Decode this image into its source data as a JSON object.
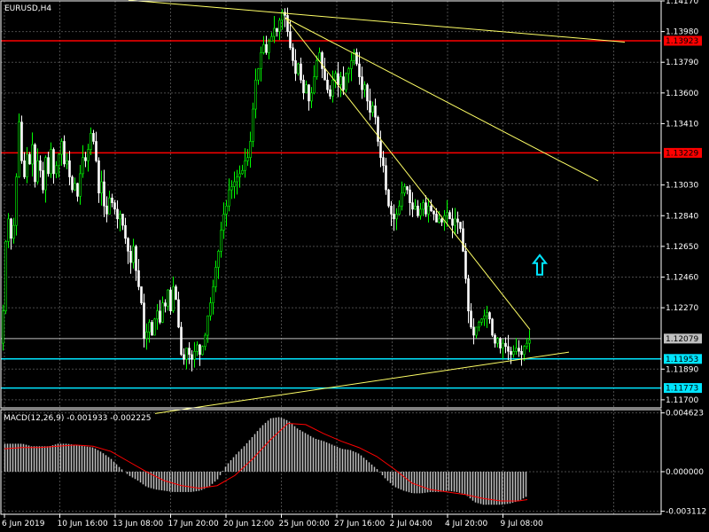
{
  "window": {
    "title": "EURUSD,H4"
  },
  "indicator": {
    "label": "MACD(12,26,9) -0.001933 -0.002225"
  },
  "colors": {
    "background": "#000000",
    "grid": "#4a4a4a",
    "frame": "#ffffff",
    "axis_text": "#ffffff",
    "bull_candle": "#00ff00",
    "bear_candle": "#ffffff",
    "trendline": "#ffff66",
    "resistance": "#ff0000",
    "support": "#00e5ff",
    "current_price_tag": "#c0c0c0",
    "macd_histogram": "#c0c0c0",
    "macd_signal": "#ff0000",
    "arrow": "#00e5ff"
  },
  "chart_data": [
    {
      "type": "candlestick",
      "title": "EURUSD,H4",
      "ylim": [
        1.1165,
        1.1417
      ],
      "y_tick_labels": [
        "1.14170",
        "1.13980",
        "1.13790",
        "1.13600",
        "1.13410",
        "1.13030",
        "1.12840",
        "1.12650",
        "1.12460",
        "1.12270",
        "1.11890",
        "1.11700"
      ],
      "x_tick_labels": [
        "6 Jun 2019",
        "10 Jun 16:00",
        "13 Jun 08:00",
        "17 Jun 20:00",
        "20 Jun 12:00",
        "25 Jun 00:00",
        "27 Jun 16:00",
        "2 Jul 04:00",
        "4 Jul 20:00",
        "9 Jul 08:00"
      ],
      "grid": true,
      "close_series": [
        [
          0,
          1.1205
        ],
        [
          3,
          1.1225
        ],
        [
          6,
          1.1268
        ],
        [
          9,
          1.1282
        ],
        [
          12,
          1.127
        ],
        [
          15,
          1.1278
        ],
        [
          18,
          1.1308
        ],
        [
          21,
          1.1342
        ],
        [
          24,
          1.1318
        ],
        [
          27,
          1.1308
        ],
        [
          30,
          1.1322
        ],
        [
          33,
          1.1316
        ],
        [
          36,
          1.1328
        ],
        [
          39,
          1.1305
        ],
        [
          42,
          1.1318
        ],
        [
          45,
          1.1312
        ],
        [
          48,
          1.13
        ],
        [
          51,
          1.132
        ],
        [
          54,
          1.131
        ],
        [
          57,
          1.1325
        ],
        [
          60,
          1.131
        ],
        [
          63,
          1.1315
        ],
        [
          66,
          1.1322
        ],
        [
          69,
          1.133
        ],
        [
          72,
          1.1316
        ],
        [
          75,
          1.1318
        ],
        [
          78,
          1.1308
        ],
        [
          81,
          1.13
        ],
        [
          84,
          1.1304
        ],
        [
          87,
          1.1296
        ],
        [
          90,
          1.131
        ],
        [
          93,
          1.132
        ],
        [
          96,
          1.1318
        ],
        [
          99,
          1.1325
        ],
        [
          102,
          1.1335
        ],
        [
          105,
          1.133
        ],
        [
          108,
          1.1318
        ],
        [
          111,
          1.1298
        ],
        [
          114,
          1.1305
        ],
        [
          117,
          1.129
        ],
        [
          120,
          1.1285
        ],
        [
          123,
          1.1295
        ],
        [
          126,
          1.1292
        ],
        [
          129,
          1.1288
        ],
        [
          132,
          1.1282
        ],
        [
          135,
          1.1285
        ],
        [
          138,
          1.1278
        ],
        [
          141,
          1.127
        ],
        [
          144,
          1.1262
        ],
        [
          147,
          1.1255
        ],
        [
          150,
          1.1265
        ],
        [
          153,
          1.125
        ],
        [
          156,
          1.124
        ],
        [
          159,
          1.123
        ],
        [
          162,
          1.1208
        ],
        [
          165,
          1.1212
        ],
        [
          168,
          1.1218
        ],
        [
          171,
          1.121
        ],
        [
          174,
          1.122
        ],
        [
          177,
          1.1225
        ],
        [
          180,
          1.1218
        ],
        [
          183,
          1.123
        ],
        [
          186,
          1.1228
        ],
        [
          189,
          1.1238
        ],
        [
          192,
          1.1225
        ],
        [
          195,
          1.124
        ],
        [
          198,
          1.1232
        ],
        [
          201,
          1.1215
        ],
        [
          204,
          1.1198
        ],
        [
          207,
          1.1195
        ],
        [
          210,
          1.1202
        ],
        [
          213,
          1.1198
        ],
        [
          216,
          1.1195
        ],
        [
          219,
          1.12
        ],
        [
          222,
          1.1204
        ],
        [
          225,
          1.1198
        ],
        [
          228,
          1.1203
        ],
        [
          231,
          1.121
        ],
        [
          234,
          1.1222
        ],
        [
          237,
          1.123
        ],
        [
          240,
          1.124
        ],
        [
          243,
          1.1252
        ],
        [
          246,
          1.1262
        ],
        [
          249,
          1.1275
        ],
        [
          252,
          1.1285
        ],
        [
          255,
          1.129
        ],
        [
          258,
          1.13
        ],
        [
          261,
          1.1302
        ],
        [
          264,
          1.1305
        ],
        [
          267,
          1.1308
        ],
        [
          270,
          1.131
        ],
        [
          273,
          1.1312
        ],
        [
          276,
          1.1318
        ],
        [
          279,
          1.132
        ],
        [
          282,
          1.133
        ],
        [
          285,
          1.135
        ],
        [
          288,
          1.1368
        ],
        [
          291,
          1.1375
        ],
        [
          294,
          1.1385
        ],
        [
          297,
          1.139
        ],
        [
          300,
          1.1385
        ],
        [
          303,
          1.1392
        ],
        [
          306,
          1.1395
        ],
        [
          309,
          1.14
        ],
        [
          312,
          1.1398
        ],
        [
          315,
          1.1405
        ],
        [
          318,
          1.141
        ],
        [
          321,
          1.1408
        ],
        [
          324,
          1.1398
        ],
        [
          327,
          1.1388
        ],
        [
          330,
          1.138
        ],
        [
          333,
          1.1372
        ],
        [
          336,
          1.1378
        ],
        [
          339,
          1.1368
        ],
        [
          342,
          1.136
        ],
        [
          345,
          1.1365
        ],
        [
          348,
          1.1355
        ],
        [
          351,
          1.136
        ],
        [
          354,
          1.137
        ],
        [
          357,
          1.138
        ],
        [
          360,
          1.1385
        ],
        [
          363,
          1.1375
        ],
        [
          366,
          1.1368
        ],
        [
          369,
          1.1362
        ],
        [
          372,
          1.1358
        ],
        [
          375,
          1.1368
        ],
        [
          378,
          1.1372
        ],
        [
          381,
          1.1365
        ],
        [
          384,
          1.137
        ],
        [
          387,
          1.1362
        ],
        [
          390,
          1.1372
        ],
        [
          393,
          1.1375
        ],
        [
          396,
          1.138
        ],
        [
          399,
          1.1385
        ],
        [
          402,
          1.1378
        ],
        [
          405,
          1.137
        ],
        [
          408,
          1.1362
        ],
        [
          411,
          1.1365
        ],
        [
          414,
          1.1355
        ],
        [
          417,
          1.1348
        ],
        [
          420,
          1.1352
        ],
        [
          423,
          1.1345
        ],
        [
          426,
          1.133
        ],
        [
          429,
          1.132
        ],
        [
          432,
          1.1315
        ],
        [
          435,
          1.13
        ],
        [
          438,
          1.129
        ],
        [
          441,
          1.1285
        ],
        [
          444,
          1.1282
        ],
        [
          447,
          1.1285
        ],
        [
          450,
          1.129
        ],
        [
          453,
          1.1298
        ],
        [
          456,
          1.1302
        ],
        [
          459,
          1.13
        ],
        [
          462,
          1.1292
        ],
        [
          465,
          1.1288
        ],
        [
          468,
          1.129
        ],
        [
          471,
          1.1284
        ],
        [
          474,
          1.1288
        ],
        [
          477,
          1.1292
        ],
        [
          480,
          1.1285
        ],
        [
          483,
          1.129
        ],
        [
          486,
          1.1287
        ],
        [
          489,
          1.1285
        ],
        [
          492,
          1.128
        ],
        [
          495,
          1.1282
        ],
        [
          498,
          1.128
        ],
        [
          501,
          1.1284
        ],
        [
          504,
          1.1286
        ],
        [
          507,
          1.1282
        ],
        [
          510,
          1.1278
        ],
        [
          513,
          1.1282
        ],
        [
          516,
          1.128
        ],
        [
          519,
          1.1276
        ],
        [
          522,
          1.1262
        ],
        [
          525,
          1.1245
        ],
        [
          528,
          1.1225
        ],
        [
          531,
          1.1215
        ],
        [
          534,
          1.121
        ],
        [
          537,
          1.1215
        ],
        [
          540,
          1.1218
        ],
        [
          543,
          1.122
        ],
        [
          546,
          1.1222
        ],
        [
          549,
          1.1224
        ],
        [
          552,
          1.122
        ],
        [
          555,
          1.121
        ],
        [
          558,
          1.1205
        ],
        [
          561,
          1.1208
        ],
        [
          564,
          1.1202
        ],
        [
          567,
          1.1205
        ],
        [
          570,
          1.1203
        ],
        [
          573,
          1.12
        ],
        [
          576,
          1.1198
        ],
        [
          579,
          1.12
        ],
        [
          582,
          1.1202
        ],
        [
          585,
          1.12
        ],
        [
          588,
          1.1198
        ],
        [
          591,
          1.1203
        ],
        [
          594,
          1.1205
        ],
        [
          597,
          1.1207
        ]
      ],
      "horizontal_levels": [
        {
          "value": 1.13923,
          "label": "1.13923",
          "color": "#ff0000"
        },
        {
          "value": 1.13229,
          "label": "1.13229",
          "color": "#ff0000"
        },
        {
          "value": 1.11953,
          "label": "1.11953",
          "color": "#00e5ff"
        },
        {
          "value": 1.11773,
          "label": "1.11773",
          "color": "#00e5ff"
        }
      ],
      "current_price": {
        "value": 1.12079,
        "label": "1.12079"
      },
      "trendlines": [
        {
          "x1": 145,
          "y1": 1.14175,
          "x2": 705,
          "y2": 1.13915
        },
        {
          "x1": 322,
          "y1": 1.14065,
          "x2": 675,
          "y2": 1.13055
        },
        {
          "x1": 322,
          "y1": 1.14065,
          "x2": 598,
          "y2": 1.12135
        },
        {
          "x1": 175,
          "y1": 1.11615,
          "x2": 642,
          "y2": 1.11995
        }
      ],
      "arrow": {
        "x": 609,
        "value": 1.1253,
        "direction": "up"
      }
    },
    {
      "type": "histogram",
      "title": "MACD(12,26,9) -0.001933 -0.002225",
      "ylim": [
        -0.00335,
        0.00488
      ],
      "y_tick_labels": [
        "0.004623",
        "0.000000",
        "-0.003112"
      ],
      "macd": [
        [
          5,
          0.0022
        ],
        [
          15,
          0.0022
        ],
        [
          25,
          0.0022
        ],
        [
          35,
          0.002
        ],
        [
          45,
          0.002
        ],
        [
          55,
          0.002
        ],
        [
          65,
          0.0022
        ],
        [
          75,
          0.0022
        ],
        [
          85,
          0.0021
        ],
        [
          95,
          0.002
        ],
        [
          105,
          0.0019
        ],
        [
          115,
          0.0015
        ],
        [
          125,
          0.001
        ],
        [
          135,
          0.0003
        ],
        [
          145,
          -0.0003
        ],
        [
          155,
          -0.0007
        ],
        [
          165,
          -0.0012
        ],
        [
          175,
          -0.0014
        ],
        [
          185,
          -0.0015
        ],
        [
          195,
          -0.0016
        ],
        [
          205,
          -0.0016
        ],
        [
          215,
          -0.0016
        ],
        [
          225,
          -0.0015
        ],
        [
          235,
          -0.0012
        ],
        [
          245,
          -0.0006
        ],
        [
          255,
          0.0005
        ],
        [
          265,
          0.0013
        ],
        [
          275,
          0.002
        ],
        [
          285,
          0.0028
        ],
        [
          295,
          0.0036
        ],
        [
          305,
          0.0042
        ],
        [
          315,
          0.0043
        ],
        [
          325,
          0.004
        ],
        [
          335,
          0.0034
        ],
        [
          345,
          0.003
        ],
        [
          355,
          0.0026
        ],
        [
          365,
          0.0024
        ],
        [
          375,
          0.0021
        ],
        [
          385,
          0.0018
        ],
        [
          395,
          0.0017
        ],
        [
          405,
          0.0014
        ],
        [
          415,
          0.0008
        ],
        [
          425,
          0.0002
        ],
        [
          435,
          -0.0006
        ],
        [
          445,
          -0.0012
        ],
        [
          455,
          -0.0015
        ],
        [
          465,
          -0.0017
        ],
        [
          475,
          -0.0017
        ],
        [
          485,
          -0.0016
        ],
        [
          495,
          -0.0016
        ],
        [
          505,
          -0.0015
        ],
        [
          515,
          -0.0016
        ],
        [
          525,
          -0.0018
        ],
        [
          535,
          -0.0024
        ],
        [
          545,
          -0.0026
        ],
        [
          555,
          -0.0026
        ],
        [
          565,
          -0.0026
        ],
        [
          575,
          -0.0025
        ],
        [
          585,
          -0.0023
        ],
        [
          595,
          -0.0019
        ]
      ],
      "signal": [
        [
          5,
          0.0018
        ],
        [
          25,
          0.0019
        ],
        [
          45,
          0.0019
        ],
        [
          65,
          0.002
        ],
        [
          85,
          0.0021
        ],
        [
          105,
          0.002
        ],
        [
          125,
          0.0016
        ],
        [
          145,
          0.0008
        ],
        [
          165,
          0.0
        ],
        [
          185,
          -0.0007
        ],
        [
          205,
          -0.0011
        ],
        [
          225,
          -0.0013
        ],
        [
          245,
          -0.0011
        ],
        [
          265,
          -0.0003
        ],
        [
          285,
          0.001
        ],
        [
          305,
          0.0025
        ],
        [
          325,
          0.0038
        ],
        [
          345,
          0.0037
        ],
        [
          365,
          0.003
        ],
        [
          385,
          0.0024
        ],
        [
          405,
          0.0019
        ],
        [
          425,
          0.0012
        ],
        [
          445,
          0.0002
        ],
        [
          465,
          -0.0009
        ],
        [
          485,
          -0.0014
        ],
        [
          505,
          -0.0016
        ],
        [
          525,
          -0.0018
        ],
        [
          545,
          -0.0021
        ],
        [
          565,
          -0.0023
        ],
        [
          585,
          -0.0023
        ],
        [
          595,
          -0.0022
        ]
      ]
    }
  ]
}
